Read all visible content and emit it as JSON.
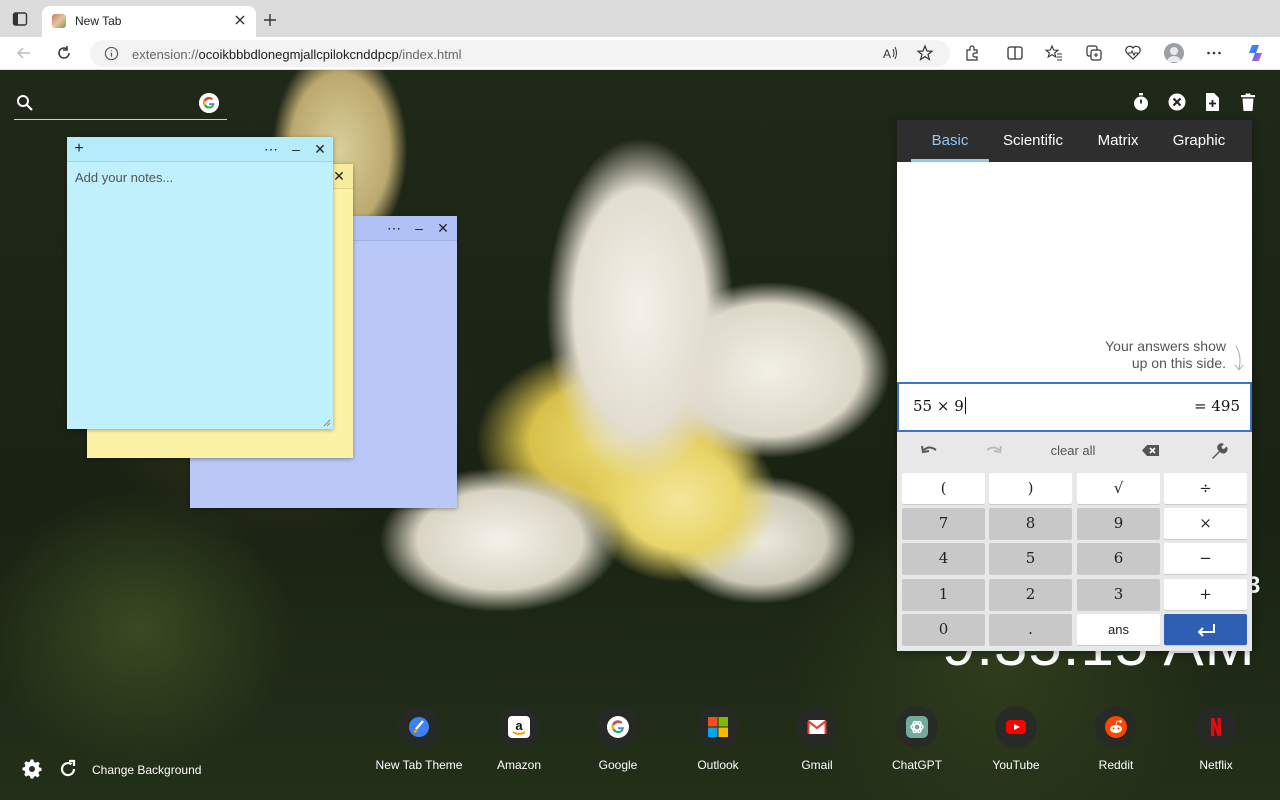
{
  "browser": {
    "tab_title": "New Tab",
    "address_prefix": "extension://",
    "address_host": "ocoikbbbdlonegmjallcpilokcnddpcp",
    "address_path": "/index.html"
  },
  "search": {
    "placeholder": ""
  },
  "notes": {
    "front_placeholder": "Add your notes...",
    "front_color": "#bff0fc",
    "middle_color": "#fcf2a6",
    "back_color": "#bac8f8"
  },
  "clock": {
    "date_fragment": "3",
    "time_fragment": "9:35:15 AM"
  },
  "calculator": {
    "tabs": [
      "Basic",
      "Scientific",
      "Matrix",
      "Graphic"
    ],
    "active_tab": "Basic",
    "hint_line1": "Your answers show",
    "hint_line2": "up on this side.",
    "expression": "55 × 9",
    "result": "= 495",
    "clear_all": "clear all",
    "keys": {
      "open_paren": "(",
      "close_paren": ")",
      "sqrt": "√",
      "divide": "÷",
      "seven": "7",
      "eight": "8",
      "nine": "9",
      "multiply": "×",
      "four": "4",
      "five": "5",
      "six": "6",
      "minus": "−",
      "one": "1",
      "two": "2",
      "three": "3",
      "plus": "+",
      "zero": "0",
      "dot": ".",
      "ans": "ans",
      "enter": "↵"
    },
    "accent_color": "#2f5fb5"
  },
  "footer": {
    "change_background": "Change Background"
  },
  "shortcuts": [
    {
      "label": "New Tab Theme",
      "icon": "paintbrush-icon"
    },
    {
      "label": "Amazon",
      "icon": "amazon-icon"
    },
    {
      "label": "Google",
      "icon": "google-icon"
    },
    {
      "label": "Outlook",
      "icon": "microsoft-icon"
    },
    {
      "label": "Gmail",
      "icon": "gmail-icon"
    },
    {
      "label": "ChatGPT",
      "icon": "chatgpt-icon"
    },
    {
      "label": "YouTube",
      "icon": "youtube-icon"
    },
    {
      "label": "Reddit",
      "icon": "reddit-icon"
    },
    {
      "label": "Netflix",
      "icon": "netflix-icon"
    }
  ]
}
